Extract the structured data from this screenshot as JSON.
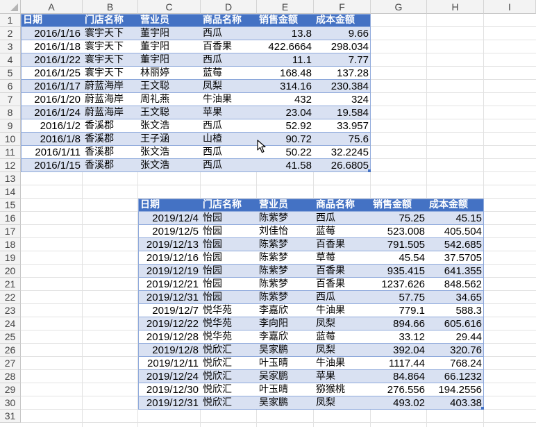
{
  "sheet": {
    "columns": [
      "A",
      "B",
      "C",
      "D",
      "E",
      "F",
      "G",
      "H",
      "I"
    ],
    "rows": [
      "1",
      "2",
      "3",
      "4",
      "5",
      "6",
      "7",
      "8",
      "9",
      "10",
      "11",
      "12",
      "13",
      "14",
      "15",
      "16",
      "17",
      "18",
      "19",
      "20",
      "21",
      "22",
      "23",
      "24",
      "25",
      "26",
      "27",
      "28",
      "29",
      "30",
      "31"
    ]
  },
  "table1": {
    "headers": [
      "日期",
      "门店名称",
      "营业员",
      "商品名称",
      "销售金额",
      "成本金额"
    ],
    "rows": [
      [
        "2016/1/16",
        "寰宇天下",
        "董宇阳",
        "西瓜",
        "13.8",
        "9.66"
      ],
      [
        "2016/1/18",
        "寰宇天下",
        "董宇阳",
        "百香果",
        "422.6664",
        "298.034"
      ],
      [
        "2016/1/22",
        "寰宇天下",
        "董宇阳",
        "西瓜",
        "11.1",
        "7.77"
      ],
      [
        "2016/1/25",
        "寰宇天下",
        "林丽婷",
        "蓝莓",
        "168.48",
        "137.28"
      ],
      [
        "2016/1/17",
        "蔚蓝海岸",
        "王文聪",
        "凤梨",
        "314.16",
        "230.384"
      ],
      [
        "2016/1/20",
        "蔚蓝海岸",
        "周礼燕",
        "牛油果",
        "432",
        "324"
      ],
      [
        "2016/1/24",
        "蔚蓝海岸",
        "王文聪",
        "苹果",
        "23.04",
        "19.584"
      ],
      [
        "2016/1/2",
        "香溪郡",
        "张文浩",
        "西瓜",
        "52.92",
        "33.957"
      ],
      [
        "2016/1/8",
        "香溪郡",
        "王子涵",
        "山楂",
        "90.72",
        "75.6"
      ],
      [
        "2016/1/11",
        "香溪郡",
        "张文浩",
        "西瓜",
        "50.22",
        "32.2245"
      ],
      [
        "2016/1/15",
        "香溪郡",
        "张文浩",
        "西瓜",
        "41.58",
        "26.6805"
      ]
    ]
  },
  "table2": {
    "headers": [
      "日期",
      "门店名称",
      "营业员",
      "商品名称",
      "销售金额",
      "成本金额"
    ],
    "rows": [
      [
        "2019/12/4",
        "怡园",
        "陈紫梦",
        "西瓜",
        "75.25",
        "45.15"
      ],
      [
        "2019/12/5",
        "怡园",
        "刘佳怡",
        "蓝莓",
        "523.008",
        "405.504"
      ],
      [
        "2019/12/13",
        "怡园",
        "陈紫梦",
        "百香果",
        "791.505",
        "542.685"
      ],
      [
        "2019/12/16",
        "怡园",
        "陈紫梦",
        "草莓",
        "45.54",
        "37.5705"
      ],
      [
        "2019/12/19",
        "怡园",
        "陈紫梦",
        "百香果",
        "935.415",
        "641.355"
      ],
      [
        "2019/12/21",
        "怡园",
        "陈紫梦",
        "百香果",
        "1237.626",
        "848.562"
      ],
      [
        "2019/12/31",
        "怡园",
        "陈紫梦",
        "西瓜",
        "57.75",
        "34.65"
      ],
      [
        "2019/12/7",
        "悦华苑",
        "李嘉欣",
        "牛油果",
        "779.1",
        "588.3"
      ],
      [
        "2019/12/22",
        "悦华苑",
        "李向阳",
        "凤梨",
        "894.66",
        "605.616"
      ],
      [
        "2019/12/28",
        "悦华苑",
        "李嘉欣",
        "蓝莓",
        "33.12",
        "29.44"
      ],
      [
        "2019/12/8",
        "悦欣汇",
        "吴家鹏",
        "凤梨",
        "392.04",
        "320.76"
      ],
      [
        "2019/12/11",
        "悦欣汇",
        "叶玉晴",
        "牛油果",
        "1117.44",
        "768.24"
      ],
      [
        "2019/12/24",
        "悦欣汇",
        "吴家鹏",
        "苹果",
        "84.864",
        "66.1232"
      ],
      [
        "2019/12/30",
        "悦欣汇",
        "叶玉晴",
        "猕猴桃",
        "276.556",
        "194.2556"
      ],
      [
        "2019/12/31",
        "悦欣汇",
        "吴家鹏",
        "凤梨",
        "493.02",
        "403.38"
      ]
    ]
  },
  "colors": {
    "table_header": "#4472c4",
    "band_light": "#d9e1f2",
    "table_border": "#8ea9db",
    "grid": "#e2e2e2",
    "heading_bg": "#f3f3f3"
  },
  "icons": {
    "cursor": "mouse-pointer-icon"
  }
}
